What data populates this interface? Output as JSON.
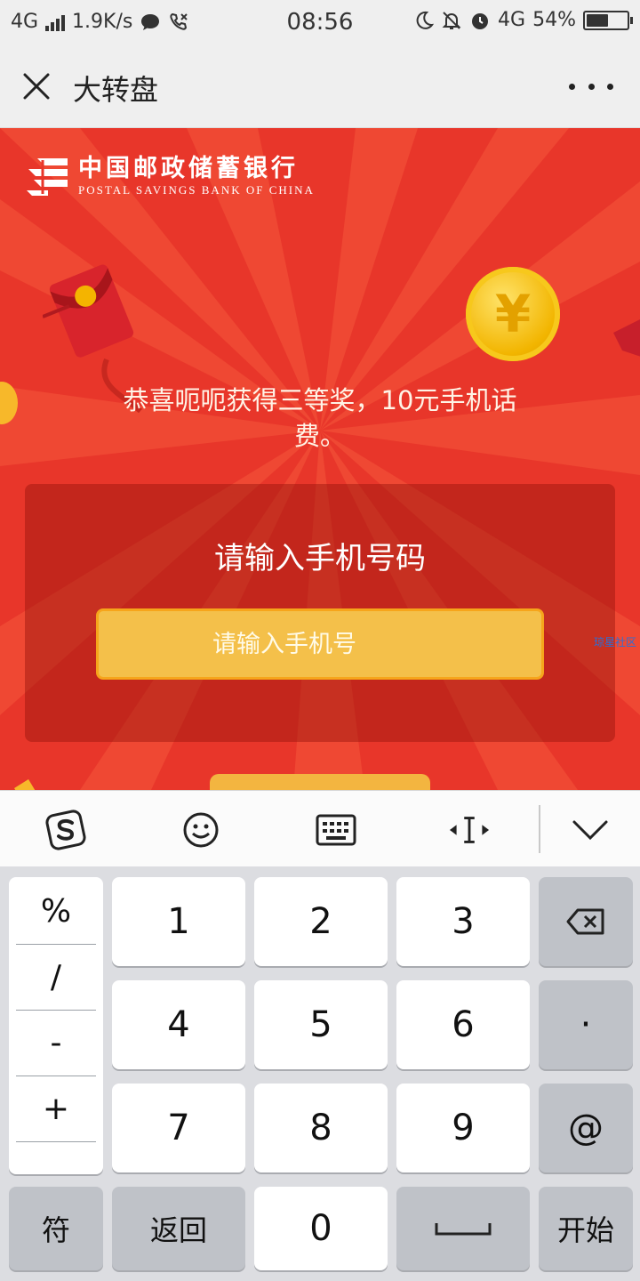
{
  "status_bar": {
    "network_label": "4G",
    "speed": "1.9K/s",
    "time": "08:56",
    "network_right": "4G",
    "battery": "54%",
    "battery_level": 0.54
  },
  "titlebar": {
    "title": "大转盘"
  },
  "bank": {
    "name_cn": "中国邮政储蓄银行",
    "name_en": "POSTAL SAVINGS BANK OF CHINA"
  },
  "coin_symbol": "¥",
  "prize_message": "恭喜呃呃获得三等奖，10元手机话费。",
  "panel": {
    "title": "请输入手机号码",
    "input_placeholder": "请输入手机号",
    "input_value": ""
  },
  "watermark": "琼星社区",
  "keyboard": {
    "symbols": [
      "%",
      "/",
      "-",
      "+"
    ],
    "rows": [
      [
        "1",
        "2",
        "3"
      ],
      [
        "4",
        "5",
        "6"
      ],
      [
        "7",
        "8",
        "9"
      ]
    ],
    "dot": "·",
    "at": "@",
    "symbol_key": "符",
    "back_key": "返回",
    "zero_key": "0",
    "go_key": "开始"
  },
  "colors": {
    "background_red": "#e8362a",
    "input_yellow": "#f4c04a",
    "coin_gold": "#f2b500"
  }
}
